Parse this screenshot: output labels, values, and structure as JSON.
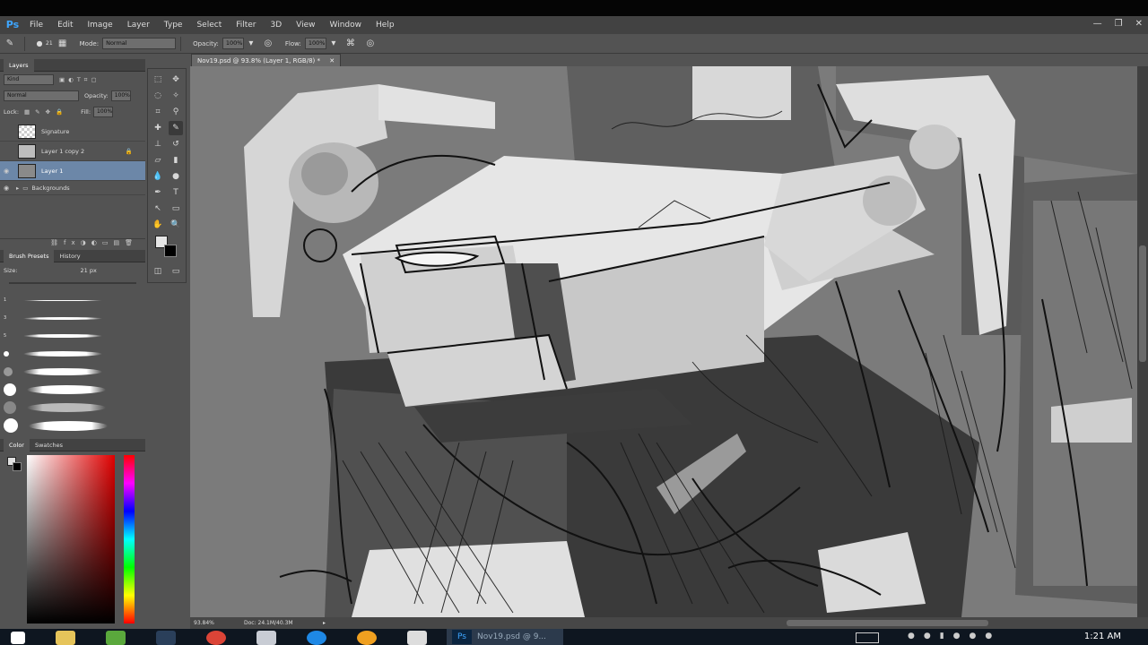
{
  "menubar": {
    "logo": "Ps",
    "items": [
      "File",
      "Edit",
      "Image",
      "Layer",
      "Type",
      "Select",
      "Filter",
      "3D",
      "View",
      "Window",
      "Help"
    ]
  },
  "options": {
    "brush_size": "21",
    "mode_label": "Mode:",
    "mode_value": "Normal",
    "opacity_label": "Opacity:",
    "opacity_value": "100%",
    "flow_label": "Flow:",
    "flow_value": "100%"
  },
  "layers_panel": {
    "title": "Layers",
    "kind_filter": "Kind",
    "blend_mode": "Normal",
    "opacity_label": "Opacity:",
    "opacity_value": "100%",
    "lock_label": "Lock:",
    "fill_label": "Fill:",
    "fill_value": "100%",
    "layers": [
      {
        "name": "Signature",
        "visible": false,
        "selected": false,
        "locked": false
      },
      {
        "name": "Layer 1 copy 2",
        "visible": false,
        "selected": false,
        "locked": true
      },
      {
        "name": "Layer 1",
        "visible": true,
        "selected": true,
        "locked": false
      },
      {
        "name": "Backgrounds",
        "visible": true,
        "selected": false,
        "locked": false
      }
    ]
  },
  "brush_panel": {
    "tab_brush": "Brush Presets",
    "tab_history": "History",
    "size_label": "Size:",
    "size_value": "21 px",
    "sizes": [
      "1",
      "3",
      "5",
      "10"
    ]
  },
  "color_panel": {
    "tab_color": "Color",
    "tab_swatches": "Swatches"
  },
  "document": {
    "tab_title": "Nov19.psd @ 93.8% (Layer 1, RGB/8) *",
    "zoom": "93.84%",
    "doc_info": "Doc: 24.1M/40.3M"
  },
  "taskbar": {
    "active_app_label": "Nov19.psd @ 9...",
    "clock": "1:21 AM"
  },
  "colors": {
    "accent": "#6c87a8",
    "bg_panel": "#535353",
    "ps_blue": "#3ea6ff"
  }
}
